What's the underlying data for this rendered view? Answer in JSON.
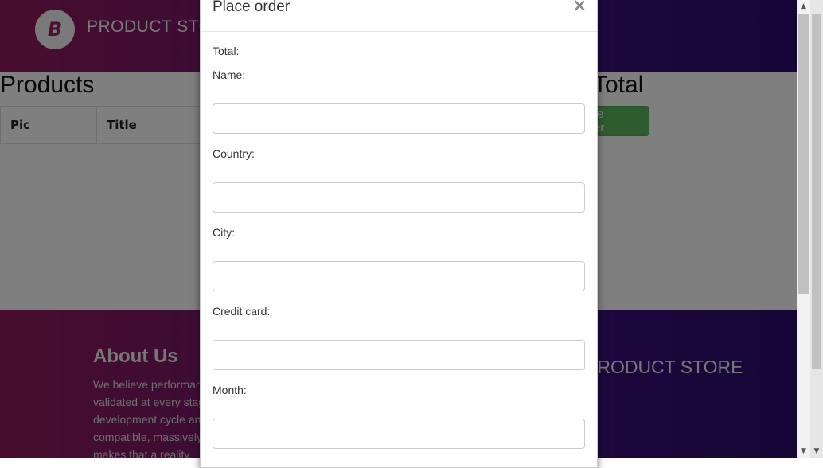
{
  "navbar": {
    "logo_letter": "B",
    "brand": "PRODUCT STORE"
  },
  "content": {
    "products_heading": "Products",
    "columns": [
      "Pic",
      "Title"
    ],
    "total_heading": "Total",
    "place_order_label": "Place Order"
  },
  "footer": {
    "about_title": "About Us",
    "about_lines": [
      "We believe performance needs to be",
      "validated at every stage of the software",
      "development cycle and our open source",
      "compatible, massively scalable platform",
      "makes that a reality."
    ],
    "brand": "PRODUCT STORE"
  },
  "modal": {
    "title": "Place order",
    "close_symbol": "×",
    "total_label": "Total:",
    "fields": [
      {
        "label": "Name:",
        "value": ""
      },
      {
        "label": "Country:",
        "value": ""
      },
      {
        "label": "City:",
        "value": ""
      },
      {
        "label": "Credit card:",
        "value": ""
      },
      {
        "label": "Month:",
        "value": ""
      }
    ]
  },
  "scrollbar": {
    "up_arrow": "▲",
    "down_arrow": "▼"
  }
}
